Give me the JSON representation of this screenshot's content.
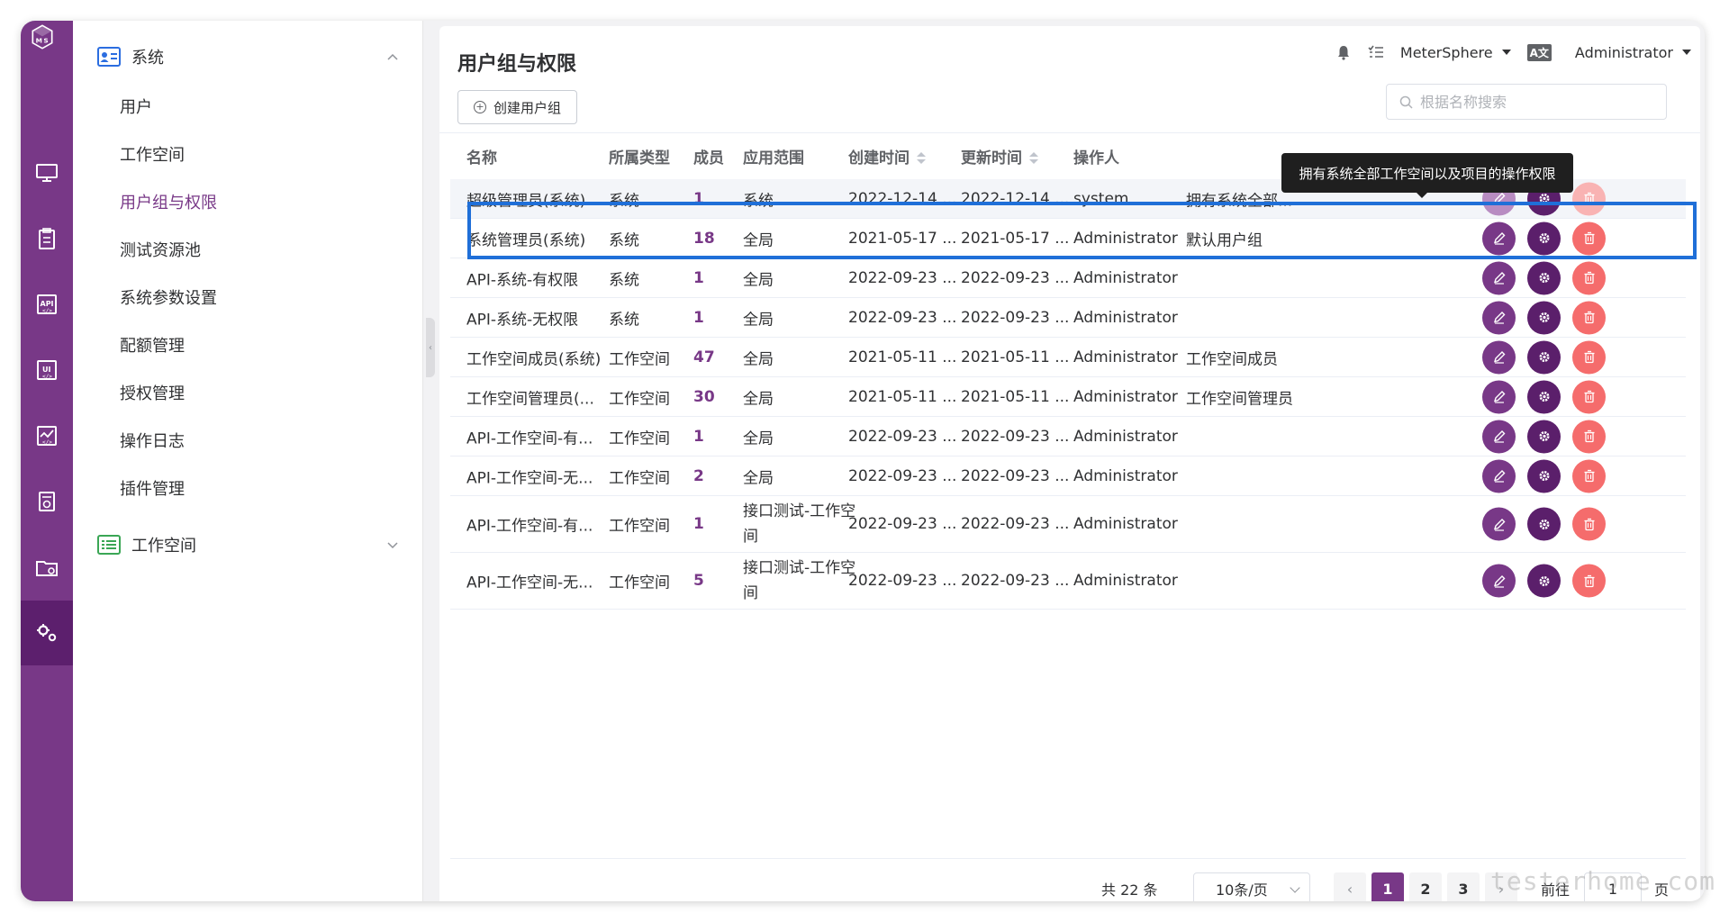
{
  "sidebar": {
    "group_system": {
      "label": "系统",
      "icon": "id-card-icon"
    },
    "items": [
      {
        "label": "用户"
      },
      {
        "label": "工作空间"
      },
      {
        "label": "用户组与权限",
        "active": true
      },
      {
        "label": "测试资源池"
      },
      {
        "label": "系统参数设置"
      },
      {
        "label": "配额管理"
      },
      {
        "label": "授权管理"
      },
      {
        "label": "操作日志"
      },
      {
        "label": "插件管理"
      }
    ],
    "group_workspace": {
      "label": "工作空间",
      "icon": "list-icon"
    }
  },
  "rail": {
    "logo": "MS",
    "icons": [
      "monitor-icon",
      "clipboard-icon",
      "api-icon",
      "ui-icon",
      "performance-icon",
      "report-icon",
      "folder-icon",
      "settings-icon"
    ]
  },
  "header": {
    "title": "用户组与权限",
    "create_label": "创建用户组",
    "workspace": "MeterSphere",
    "user": "Administrator",
    "lang_icon": "A文",
    "search_placeholder": "根据名称搜索"
  },
  "table": {
    "columns": {
      "name": "名称",
      "type": "所属类型",
      "member": "成员",
      "scope": "应用范围",
      "created": "创建时间",
      "updated": "更新时间",
      "creator": "操作人"
    },
    "rows": [
      {
        "name": "超级管理员(系统)",
        "type": "系统",
        "member": "1",
        "scope": "系统",
        "created": "2022-12-14 ...",
        "updated": "2022-12-14 ...",
        "creator": "system",
        "desc": "拥有系统全部..."
      },
      {
        "name": "系统管理员(系统)",
        "type": "系统",
        "member": "18",
        "scope": "全局",
        "created": "2021-05-17 ...",
        "updated": "2021-05-17 ...",
        "creator": "Administrator",
        "desc": "默认用户组"
      },
      {
        "name": "API-系统-有权限",
        "type": "系统",
        "member": "1",
        "scope": "全局",
        "created": "2022-09-23 ...",
        "updated": "2022-09-23 ...",
        "creator": "Administrator",
        "desc": ""
      },
      {
        "name": "API-系统-无权限",
        "type": "系统",
        "member": "1",
        "scope": "全局",
        "created": "2022-09-23 ...",
        "updated": "2022-09-23 ...",
        "creator": "Administrator",
        "desc": ""
      },
      {
        "name": "工作空间成员(系统)",
        "type": "工作空间",
        "member": "47",
        "scope": "全局",
        "created": "2021-05-11 ...",
        "updated": "2021-05-11 ...",
        "creator": "Administrator",
        "desc": "工作空间成员"
      },
      {
        "name": "工作空间管理员(...",
        "type": "工作空间",
        "member": "30",
        "scope": "全局",
        "created": "2021-05-11 ...",
        "updated": "2021-05-11 ...",
        "creator": "Administrator",
        "desc": "工作空间管理员"
      },
      {
        "name": "API-工作空间-有...",
        "type": "工作空间",
        "member": "1",
        "scope": "全局",
        "created": "2022-09-23 ...",
        "updated": "2022-09-23 ...",
        "creator": "Administrator",
        "desc": ""
      },
      {
        "name": "API-工作空间-无...",
        "type": "工作空间",
        "member": "2",
        "scope": "全局",
        "created": "2022-09-23 ...",
        "updated": "2022-09-23 ...",
        "creator": "Administrator",
        "desc": ""
      },
      {
        "name": "API-工作空间-有...",
        "type": "工作空间",
        "member": "1",
        "scope": "接口测试-工作空间",
        "created": "2022-09-23 ...",
        "updated": "2022-09-23 ...",
        "creator": "Administrator",
        "desc": ""
      },
      {
        "name": "API-工作空间-无...",
        "type": "工作空间",
        "member": "5",
        "scope": "接口测试-工作空间",
        "created": "2022-09-23 ...",
        "updated": "2022-09-23 ...",
        "creator": "Administrator",
        "desc": ""
      }
    ]
  },
  "tooltip": "拥有系统全部工作空间以及项目的操作权限",
  "pagination": {
    "total": "共 22 条",
    "page_size": "10条/页",
    "pages": [
      "1",
      "2",
      "3"
    ],
    "current": "1",
    "goto_label": "前往",
    "goto_value": "1",
    "goto_unit": "页"
  },
  "watermark": "testerhome.com",
  "colors": {
    "brand": "#783887",
    "danger": "#f56c6c",
    "selection": "#1f6fd8"
  }
}
